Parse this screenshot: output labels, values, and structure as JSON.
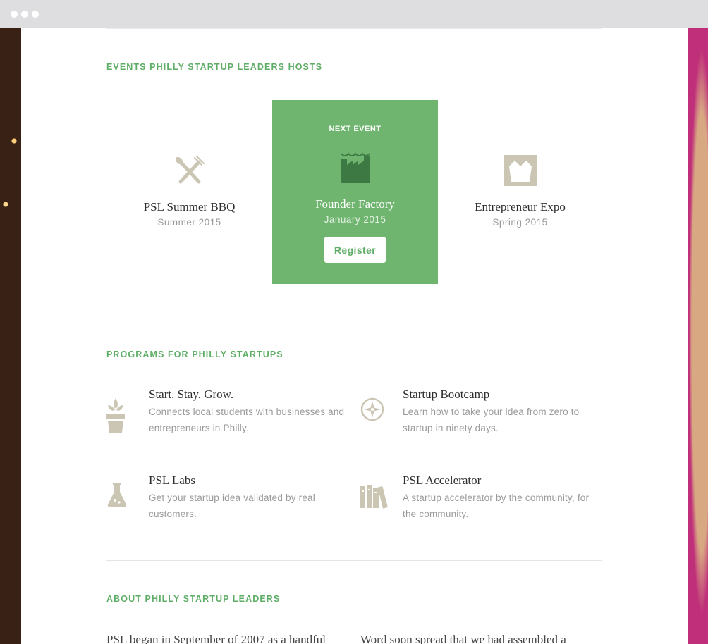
{
  "window": {
    "controls": [
      "close",
      "minimize",
      "maximize"
    ]
  },
  "colors": {
    "accent": "#5fae67",
    "featured_bg": "#6fb56f",
    "icon": "#cbc6b3",
    "title": "#2d2d2d",
    "muted": "#9a9a9a"
  },
  "events_section": {
    "heading": "EVENTS PHILLY STARTUP LEADERS HOSTS",
    "events": [
      {
        "icon": "utensils-icon",
        "title": "PSL Summer BBQ",
        "date": "Summer 2015"
      },
      {
        "icon": "factory-icon",
        "badge": "NEXT EVENT",
        "title": "Founder Factory",
        "date": "January 2015",
        "button": "Register"
      },
      {
        "icon": "stage-icon",
        "title": "Entrepreneur Expo",
        "date": "Spring 2015"
      }
    ]
  },
  "programs_section": {
    "heading": "PROGRAMS FOR PHILLY STARTUPS",
    "programs": [
      {
        "icon": "plant-icon",
        "title": "Start. Stay. Grow.",
        "description": "Connects local students with businesses and entrepreneurs in Philly."
      },
      {
        "icon": "compass-icon",
        "title": "Startup Bootcamp",
        "description": "Learn how to take your idea from zero to startup in ninety days."
      },
      {
        "icon": "flask-icon",
        "title": "PSL Labs",
        "description": "Get your startup idea validated by real customers."
      },
      {
        "icon": "books-icon",
        "title": "PSL Accelerator",
        "description": "A startup accelerator by the community, for the community."
      }
    ]
  },
  "about_section": {
    "heading": "ABOUT PHILLY STARTUP LEADERS",
    "column_1": "PSL began in September of 2007 as a handful",
    "column_2": "Word soon spread that we had assembled a"
  }
}
